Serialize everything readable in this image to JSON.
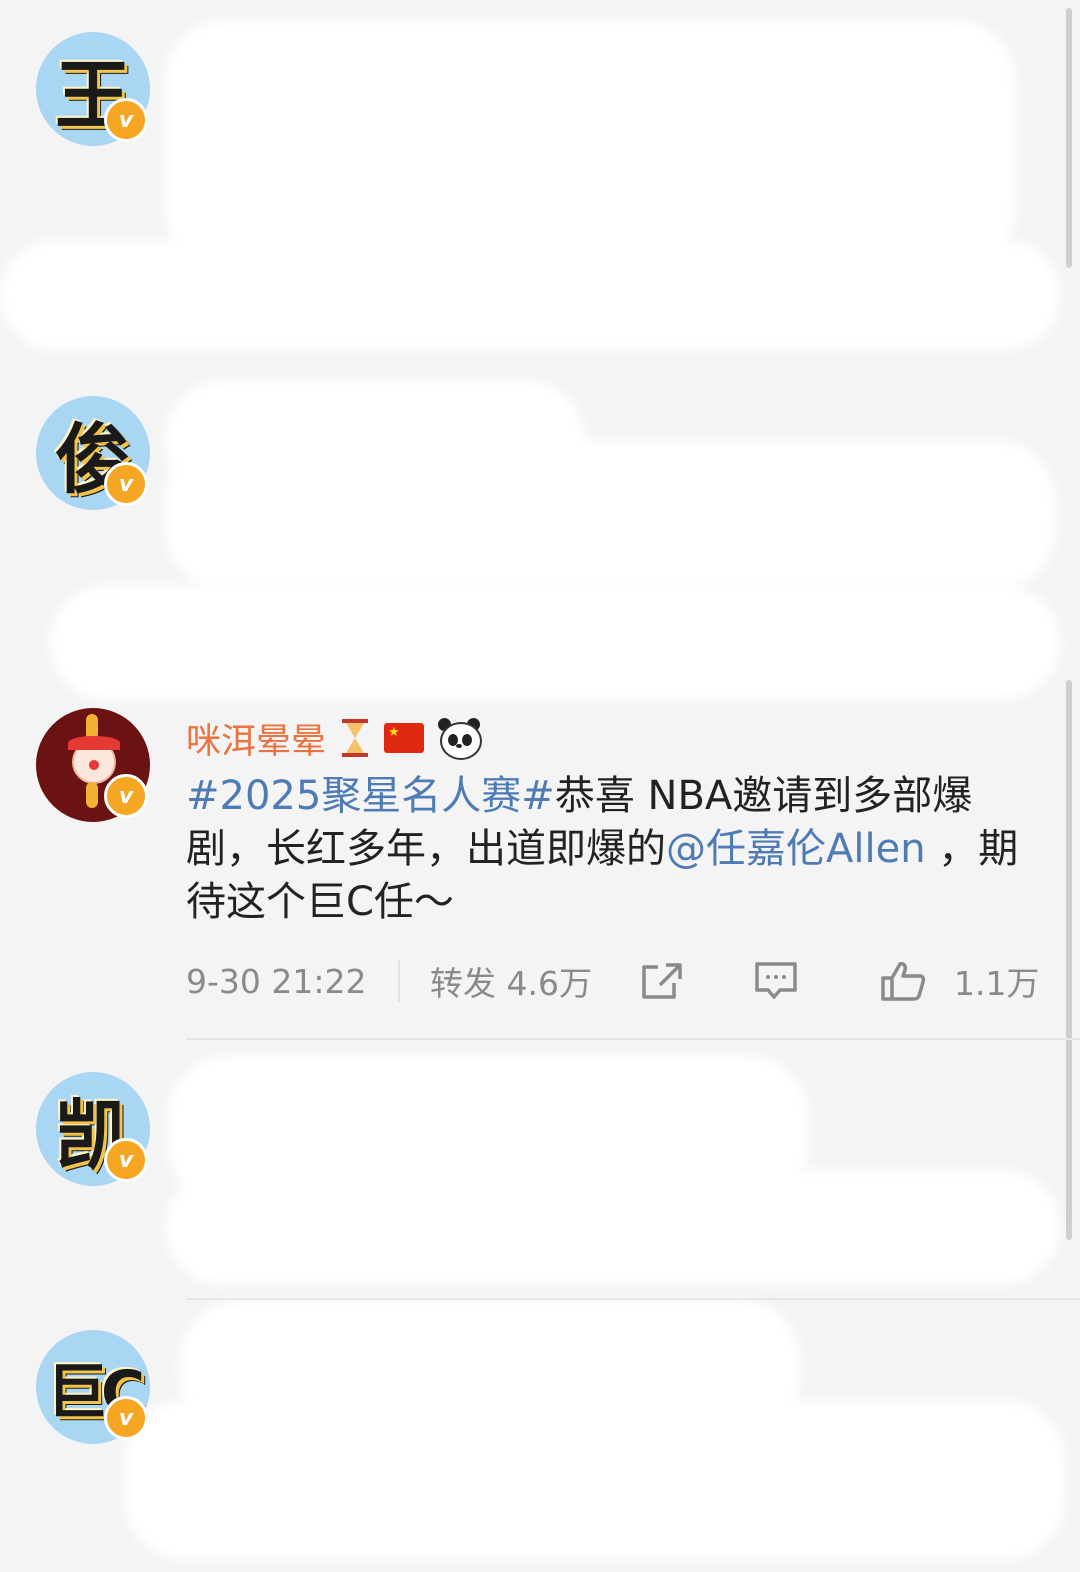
{
  "colors": {
    "username": "#eb7340",
    "link": "#4f7bb5",
    "text": "#222222",
    "meta": "#8a8a8a",
    "background": "#f4f4f4"
  },
  "avatars": [
    {
      "char": "王",
      "badge": "v"
    },
    {
      "char": "俊",
      "badge": "v"
    },
    {
      "char": "clown-emoji",
      "badge": "v"
    },
    {
      "char": "凯",
      "badge": "v"
    },
    {
      "char": "巨C",
      "badge": "v"
    }
  ],
  "post": {
    "username": "咪洱晕晕",
    "name_icons": [
      "hourglass-icon",
      "china-flag-icon",
      "panda-icon"
    ],
    "content": {
      "hashtag": "#2025聚星名人赛#",
      "text1": "恭喜 NBA邀请到多部爆剧，长红多年，出道即爆的",
      "mention": "@任嘉伦Allen",
      "text2": " ，期待这个巨C任～"
    },
    "time": "9-30 21:22",
    "repost_label": "转发 4.6万",
    "like_count": "1.1万",
    "icons": [
      "share-icon",
      "comment-icon",
      "like-icon"
    ]
  }
}
